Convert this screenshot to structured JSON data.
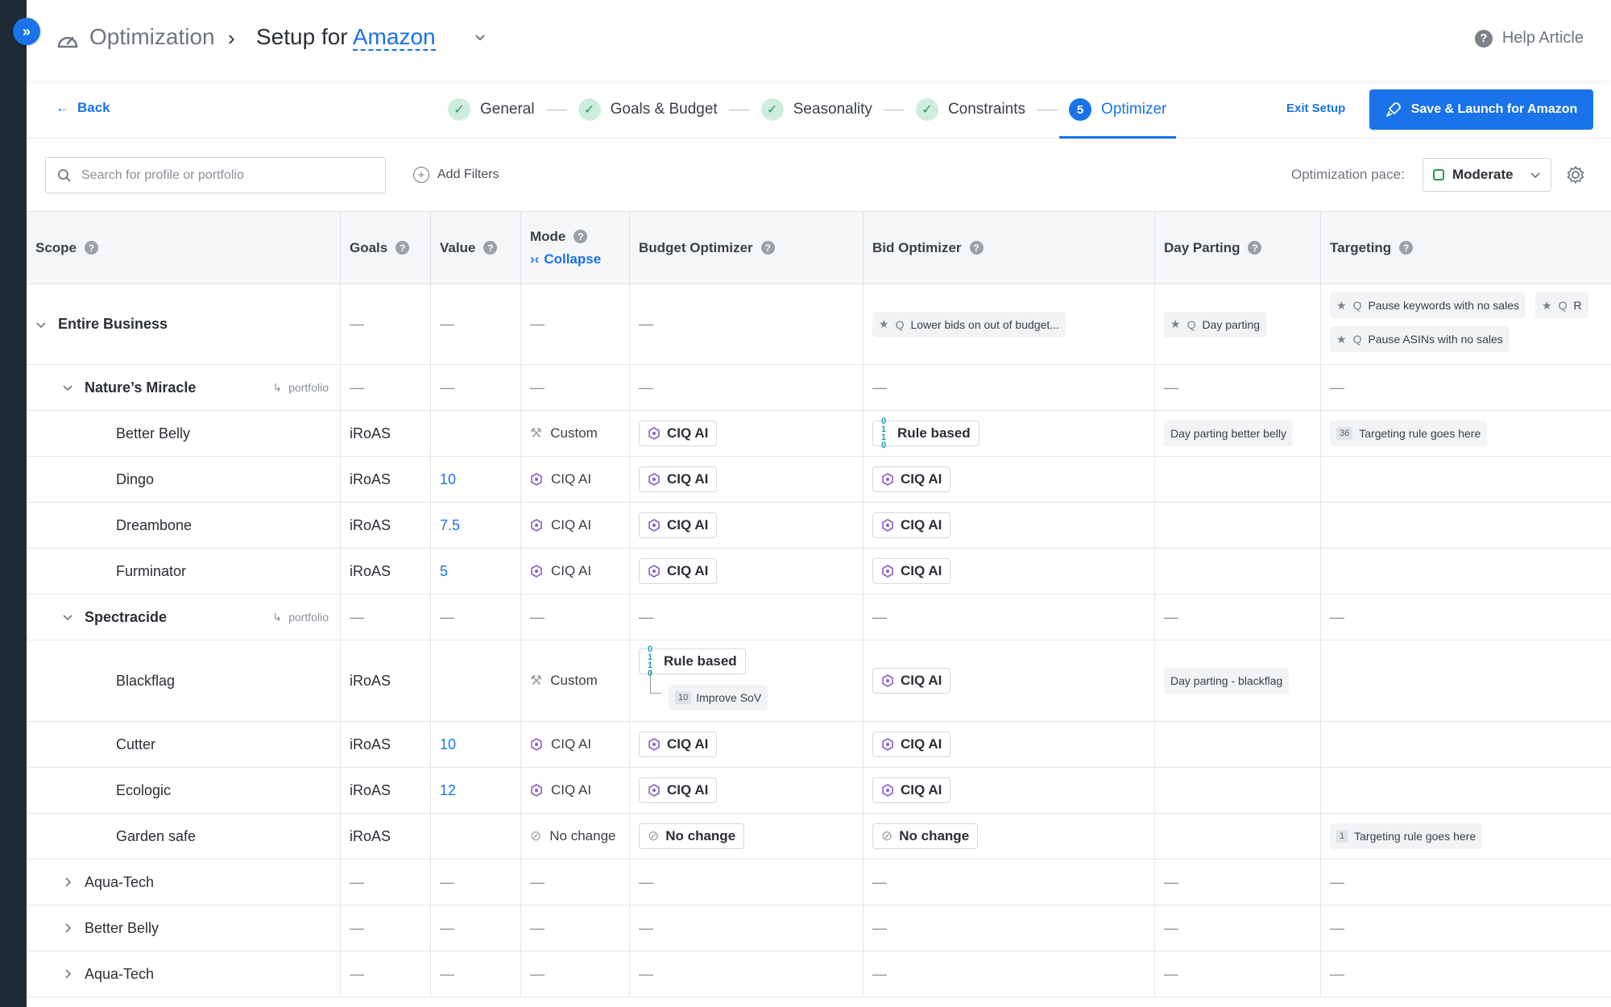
{
  "header": {
    "breadcrumb_root": "Optimization",
    "title_prefix": "Setup for ",
    "retailer": "Amazon",
    "help_label": "Help Article"
  },
  "stepbar": {
    "back_label": "Back",
    "steps": [
      {
        "label": "General",
        "state": "done"
      },
      {
        "label": "Goals & Budget",
        "state": "done"
      },
      {
        "label": "Seasonality",
        "state": "done"
      },
      {
        "label": "Constraints",
        "state": "done"
      },
      {
        "label": "Optimizer",
        "state": "active",
        "number": "5"
      }
    ],
    "exit_label": "Exit Setup",
    "launch_label": "Save & Launch for Amazon"
  },
  "filters": {
    "search_placeholder": "Search for profile or portfolio",
    "add_filters_label": "Add Filters",
    "pace_label": "Optimization pace:",
    "pace_value": "Moderate"
  },
  "table": {
    "columns": {
      "scope": "Scope",
      "goals": "Goals",
      "value": "Value",
      "mode": "Mode",
      "collapse": "Collapse",
      "budget": "Budget Optimizer",
      "bid": "Bid Optimizer",
      "day": "Day Parting",
      "target": "Targeting"
    },
    "dash": "—",
    "entire_business": {
      "scope": "Entire Business",
      "bid_tag": "Lower bids on out of budget...",
      "day_tag": "Day parting",
      "target_tag_1": "Pause keywords with no sales",
      "target_tag_2": "Pause ASINs with no sales",
      "target_tag_3": "R"
    },
    "portfolio_label": "portfolio",
    "natures": {
      "scope": "Nature’s Miracle"
    },
    "better_belly": {
      "scope": "Better Belly",
      "goal": "iRoAS",
      "mode": "Custom",
      "budget": "CIQ AI",
      "bid": "Rule based",
      "day": "Day parting better belly",
      "target_count": "36",
      "target": "Targeting rule goes here"
    },
    "dingo": {
      "scope": "Dingo",
      "goal": "iRoAS",
      "value": "10",
      "mode": "CIQ AI",
      "budget": "CIQ AI",
      "bid": "CIQ AI"
    },
    "dreambone": {
      "scope": "Dreambone",
      "goal": "iRoAS",
      "value": "7.5",
      "mode": "CIQ AI",
      "budget": "CIQ AI",
      "bid": "CIQ AI"
    },
    "furminator": {
      "scope": "Furminator",
      "goal": "iRoAS",
      "value": "5",
      "mode": "CIQ AI",
      "budget": "CIQ AI",
      "bid": "CIQ AI"
    },
    "spectracide": {
      "scope": "Spectracide"
    },
    "blackflag": {
      "scope": "Blackflag",
      "goal": "iRoAS",
      "mode": "Custom",
      "budget": "Rule based",
      "sub_count": "10",
      "sub_rule": "Improve SoV",
      "bid": "CIQ AI",
      "day": "Day parting - blackflag"
    },
    "cutter": {
      "scope": "Cutter",
      "goal": "iRoAS",
      "value": "10",
      "mode": "CIQ AI",
      "budget": "CIQ AI",
      "bid": "CIQ AI"
    },
    "ecologic": {
      "scope": "Ecologic",
      "goal": "iRoAS",
      "value": "12",
      "mode": "CIQ AI",
      "budget": "CIQ AI",
      "bid": "CIQ AI"
    },
    "garden": {
      "scope": "Garden safe",
      "goal": "iRoAS",
      "mode": "No change",
      "budget": "No change",
      "bid": "No change",
      "target_count": "1",
      "target": "Targeting rule goes here"
    },
    "aqua1": {
      "scope": "Aqua-Tech"
    },
    "betterbelly2": {
      "scope": "Better Belly"
    },
    "aqua2": {
      "scope": "Aqua-Tech"
    }
  },
  "colors": {
    "accent": "#1a73e8",
    "success": "#1f9d55",
    "rail": "#1e2a36"
  }
}
